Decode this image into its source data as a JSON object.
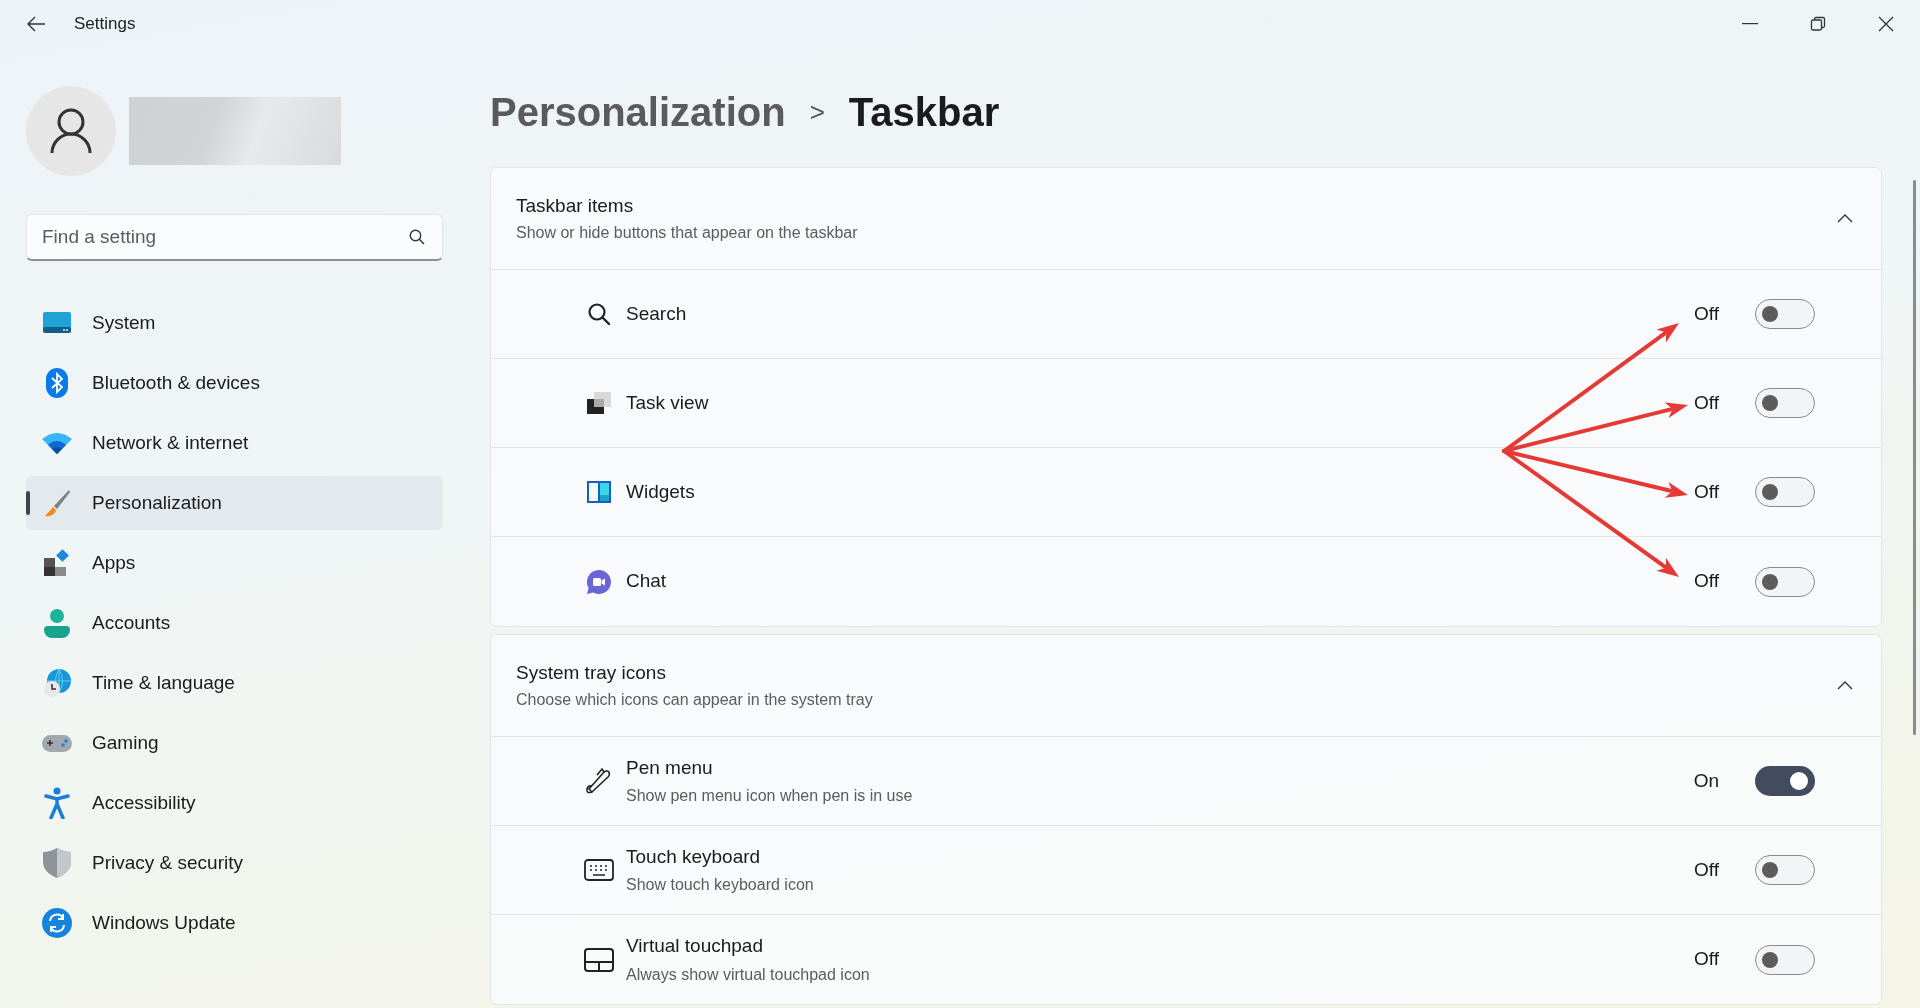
{
  "window": {
    "title": "Settings"
  },
  "search": {
    "placeholder": "Find a setting"
  },
  "sidebar": {
    "items": [
      {
        "label": "System",
        "selected": false
      },
      {
        "label": "Bluetooth & devices",
        "selected": false
      },
      {
        "label": "Network & internet",
        "selected": false
      },
      {
        "label": "Personalization",
        "selected": true
      },
      {
        "label": "Apps",
        "selected": false
      },
      {
        "label": "Accounts",
        "selected": false
      },
      {
        "label": "Time & language",
        "selected": false
      },
      {
        "label": "Gaming",
        "selected": false
      },
      {
        "label": "Accessibility",
        "selected": false
      },
      {
        "label": "Privacy & security",
        "selected": false
      },
      {
        "label": "Windows Update",
        "selected": false
      }
    ]
  },
  "breadcrumb": {
    "parent": "Personalization",
    "separator": ">",
    "current": "Taskbar"
  },
  "sections": [
    {
      "title": "Taskbar items",
      "subtitle": "Show or hide buttons that appear on the taskbar",
      "expanded": true,
      "rows": [
        {
          "label": "Search",
          "state": "Off",
          "on": false,
          "highlighted": true
        },
        {
          "label": "Task view",
          "state": "Off",
          "on": false,
          "highlighted": true
        },
        {
          "label": "Widgets",
          "state": "Off",
          "on": false,
          "highlighted": true
        },
        {
          "label": "Chat",
          "state": "Off",
          "on": false,
          "highlighted": true
        }
      ]
    },
    {
      "title": "System tray icons",
      "subtitle": "Choose which icons can appear in the system tray",
      "expanded": true,
      "rows": [
        {
          "label": "Pen menu",
          "description": "Show pen menu icon when pen is in use",
          "state": "On",
          "on": true,
          "highlighted": false
        },
        {
          "label": "Touch keyboard",
          "description": "Show touch keyboard icon",
          "state": "Off",
          "on": false,
          "highlighted": false
        },
        {
          "label": "Virtual touchpad",
          "description": "Always show virtual touchpad icon",
          "state": "Off",
          "on": false,
          "highlighted": false
        }
      ]
    }
  ]
}
